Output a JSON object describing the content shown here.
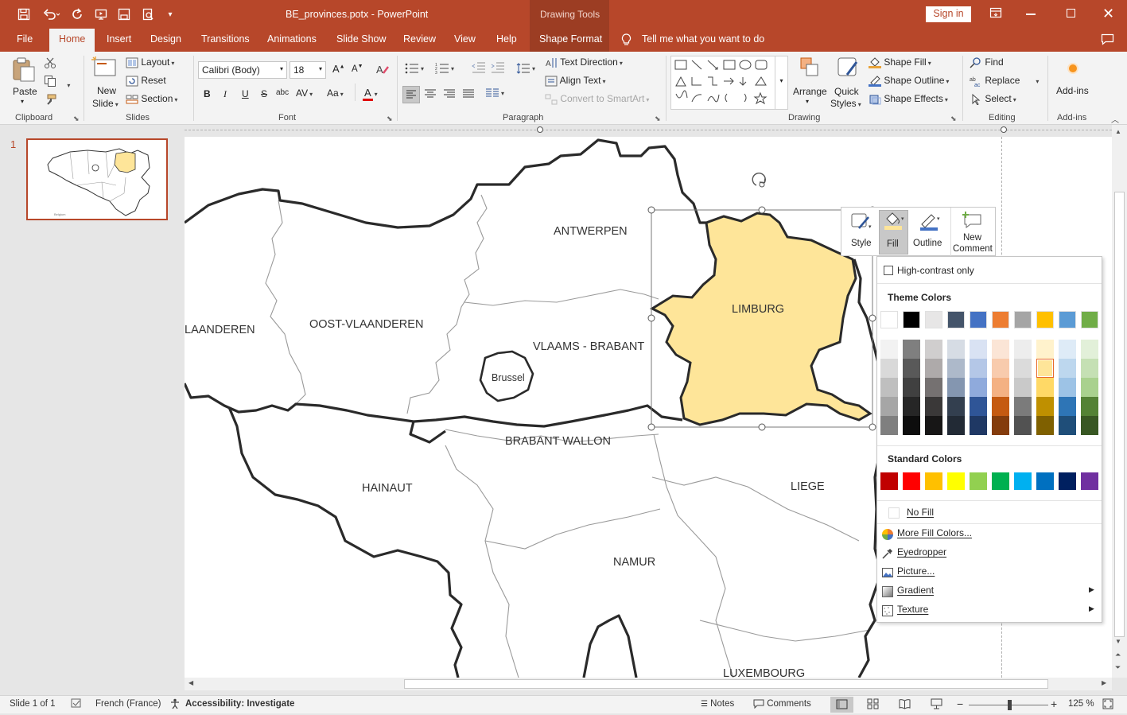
{
  "qat": {
    "save": "save-icon",
    "undo": "undo-icon",
    "redo": "repeat-icon",
    "more": "▾"
  },
  "title": "BE_provinces.potx  -  PowerPoint",
  "context_tab_group": "Drawing Tools",
  "signin": "Sign in",
  "tabs": [
    "File",
    "Home",
    "Insert",
    "Design",
    "Transitions",
    "Animations",
    "Slide Show",
    "Review",
    "View",
    "Help",
    "Shape Format"
  ],
  "tellme": "Tell me what you want to do",
  "ribbon": {
    "clipboard": {
      "label": "Clipboard",
      "paste": "Paste"
    },
    "slides": {
      "label": "Slides",
      "new_slide": "New",
      "new_slide2": "Slide",
      "layout": "Layout",
      "reset": "Reset",
      "section": "Section"
    },
    "font": {
      "label": "Font",
      "family": "Calibri (Body)",
      "size": "18",
      "bold": "B",
      "italic": "I",
      "underline": "U",
      "strike": "S",
      "spacing": "AV",
      "case": "Aa",
      "color": "A"
    },
    "paragraph": {
      "label": "Paragraph",
      "text_direction": "Text Direction",
      "align_text": "Align Text",
      "smartart": "Convert to SmartArt"
    },
    "drawing": {
      "label": "Drawing",
      "arrange": "Arrange",
      "quick_styles": "Quick",
      "quick_styles2": "Styles",
      "shape_fill": "Shape Fill",
      "shape_outline": "Shape Outline",
      "shape_effects": "Shape Effects"
    },
    "editing": {
      "label": "Editing",
      "find": "Find",
      "replace": "Replace",
      "select": "Select"
    },
    "addins": {
      "label": "Add-ins",
      "btn": "Add-ins"
    }
  },
  "slide_thumb_number": "1",
  "map": {
    "labels": [
      "ANTWERPEN",
      "LIMBURG",
      "LAANDEREN",
      "OOST-VLAANDEREN",
      "VLAAMS - BRABANT",
      "Brussel",
      "BRABANT WALLON",
      "HAINAUT",
      "LIEGE",
      "NAMUR",
      "LUXEMBOURG"
    ],
    "highlight_color": "#fee599"
  },
  "mini_toolbar": {
    "style": "Style",
    "fill": "Fill",
    "outline": "Outline",
    "new_comment": "New",
    "new_comment2": "Comment"
  },
  "fill_menu": {
    "high_contrast": "High-contrast only",
    "theme_colors_label": "Theme Colors",
    "theme_colors": [
      "#ffffff",
      "#000000",
      "#e7e6e6",
      "#44546a",
      "#4472c4",
      "#ed7d31",
      "#a5a5a5",
      "#ffc000",
      "#5b9bd5",
      "#70ad47"
    ],
    "theme_tints": [
      [
        "#f2f2f2",
        "#d9d9d9",
        "#bfbfbf",
        "#a6a6a6",
        "#7f7f7f"
      ],
      [
        "#7f7f7f",
        "#595959",
        "#404040",
        "#262626",
        "#0d0d0d"
      ],
      [
        "#d0cece",
        "#aeaaaa",
        "#757171",
        "#3a3838",
        "#171616"
      ],
      [
        "#d6dce4",
        "#adb9ca",
        "#8496b0",
        "#333f4f",
        "#222a35"
      ],
      [
        "#d9e2f3",
        "#b4c7e7",
        "#8faadc",
        "#2f5597",
        "#1f3864"
      ],
      [
        "#fbe5d6",
        "#f8cbad",
        "#f4b183",
        "#c55a11",
        "#843c0c"
      ],
      [
        "#ededed",
        "#dbdbdb",
        "#c9c9c9",
        "#7b7b7b",
        "#525252"
      ],
      [
        "#fff2cc",
        "#fee599",
        "#ffd966",
        "#bf9000",
        "#7f6000"
      ],
      [
        "#deebf7",
        "#bdd7ee",
        "#9dc3e6",
        "#2e75b6",
        "#1f4e79"
      ],
      [
        "#e2f0d9",
        "#c5e0b4",
        "#a9d18e",
        "#548235",
        "#385723"
      ]
    ],
    "standard_colors_label": "Standard Colors",
    "standard_colors": [
      "#c00000",
      "#ff0000",
      "#ffc000",
      "#ffff00",
      "#92d050",
      "#00b050",
      "#00b0f0",
      "#0070c0",
      "#002060",
      "#7030a0"
    ],
    "no_fill": "No Fill",
    "more_colors": "More Fill Colors...",
    "eyedropper": "Eyedropper",
    "picture": "Picture...",
    "gradient": "Gradient",
    "texture": "Texture"
  },
  "status": {
    "slide": "Slide 1 of 1",
    "language": "French (France)",
    "accessibility": "Accessibility: Investigate",
    "notes": "Notes",
    "comments": "Comments",
    "zoom": "125 %"
  }
}
